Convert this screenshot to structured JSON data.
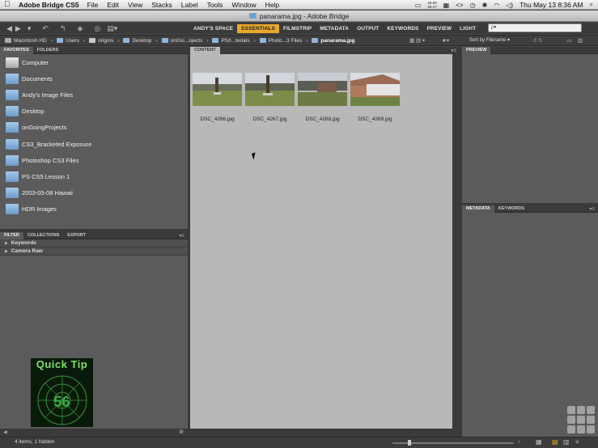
{
  "menubar": {
    "app_name": "Adobe Bridge CS5",
    "items": [
      "File",
      "Edit",
      "View",
      "Stacks",
      "Label",
      "Tools",
      "Window",
      "Help"
    ],
    "cpu_top": "25.80",
    "cpu_bottom": "25.17",
    "clock": "Thu May 13  8:36 AM"
  },
  "window": {
    "title": "panarama.jpg - Adobe Bridge"
  },
  "workspaces": [
    {
      "label": "ANDY'S SPACE",
      "active": false
    },
    {
      "label": "ESSENTIALS",
      "active": true
    },
    {
      "label": "FILMSTRIP",
      "active": false
    },
    {
      "label": "METADATA",
      "active": false
    },
    {
      "label": "OUTPUT",
      "active": false
    },
    {
      "label": "KEYWORDS",
      "active": false
    },
    {
      "label": "PREVIEW",
      "active": false
    },
    {
      "label": "LIGHT",
      "active": false
    }
  ],
  "search": {
    "placeholder": "ρ▾"
  },
  "path": [
    "Macintosh HD",
    "Users",
    "origins",
    "Desktop",
    "onGoi...ojects",
    "PS/I...terials",
    "Photo...3 Files",
    "panarama.jpg"
  ],
  "sort": {
    "label": "Sort by Filename ▾"
  },
  "left_tabs": [
    "FAVORITES",
    "FOLDERS"
  ],
  "favorites": [
    "Computer",
    "Documents",
    "Andy's Image Files",
    "Desktop",
    "onGoingProjects",
    "CS3_Bracketed Exposure",
    "Photoshop CS3 Files",
    "PS CS5 Lesson 1",
    "2003-05-08  Hawaii",
    "HDR Images"
  ],
  "filter_tabs": [
    "FILTER",
    "COLLECTIONS",
    "EXPORT"
  ],
  "filter_rows": [
    "Keywords",
    "Camera Raw"
  ],
  "quick_tip": {
    "title": "Quick Tip",
    "number": "56"
  },
  "content": {
    "tab": "CONTENT",
    "thumbnails": [
      "DSC_4266.jpg",
      "DSC_4267.jpg",
      "DSC_4268.jpg",
      "DSC_4269.jpg"
    ]
  },
  "preview_tab": "PREVIEW",
  "metadata_tabs": [
    "METADATA",
    "KEYWORDS"
  ],
  "status": {
    "text": "4 items, 1 hidden"
  }
}
